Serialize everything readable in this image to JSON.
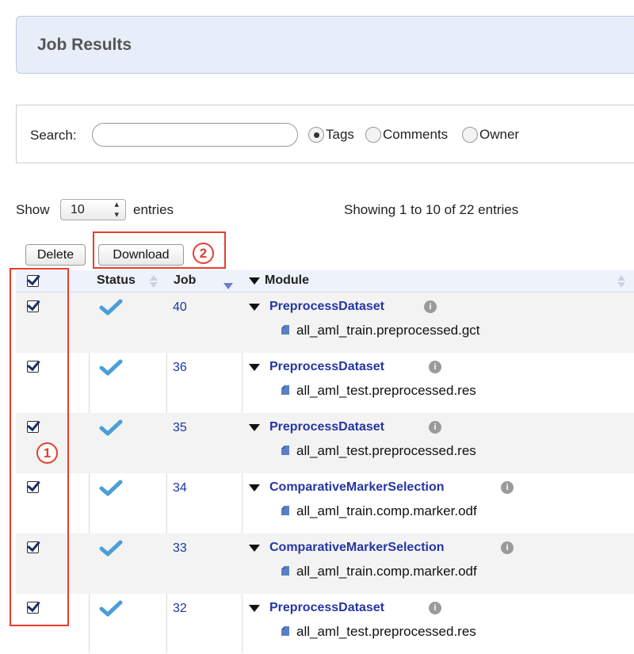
{
  "header": {
    "title": "Job Results"
  },
  "search": {
    "label": "Search:",
    "value": "",
    "placeholder": "",
    "options": [
      {
        "label": "Tags",
        "selected": true
      },
      {
        "label": "Comments",
        "selected": false
      },
      {
        "label": "Owner",
        "selected": false
      }
    ]
  },
  "entries": {
    "show_label": "Show",
    "selected": "10",
    "suffix_label": "entries",
    "info": "Showing 1 to 10 of 22 entries"
  },
  "toolbar": {
    "delete_label": "Delete",
    "download_label": "Download"
  },
  "annotations": {
    "badge_1": "1",
    "badge_2": "2",
    "color": "#e53f2e"
  },
  "table": {
    "columns": [
      "Status",
      "Job",
      "Module"
    ],
    "rows": [
      {
        "job": "40",
        "module": "PreprocessDataset",
        "file": "all_aml_train.preprocessed.gct"
      },
      {
        "job": "36",
        "module": "PreprocessDataset",
        "file": "all_aml_test.preprocessed.res"
      },
      {
        "job": "35",
        "module": "PreprocessDataset",
        "file": "all_aml_test.preprocessed.res"
      },
      {
        "job": "34",
        "module": "ComparativeMarkerSelection",
        "file": "all_aml_train.comp.marker.odf"
      },
      {
        "job": "33",
        "module": "ComparativeMarkerSelection",
        "file": "all_aml_train.comp.marker.odf"
      },
      {
        "job": "32",
        "module": "PreprocessDataset",
        "file": "all_aml_test.preprocessed.res"
      }
    ]
  },
  "colors": {
    "link": "#2536a3",
    "header_bg": "#e8eef9",
    "check": "#4a9fd8"
  }
}
